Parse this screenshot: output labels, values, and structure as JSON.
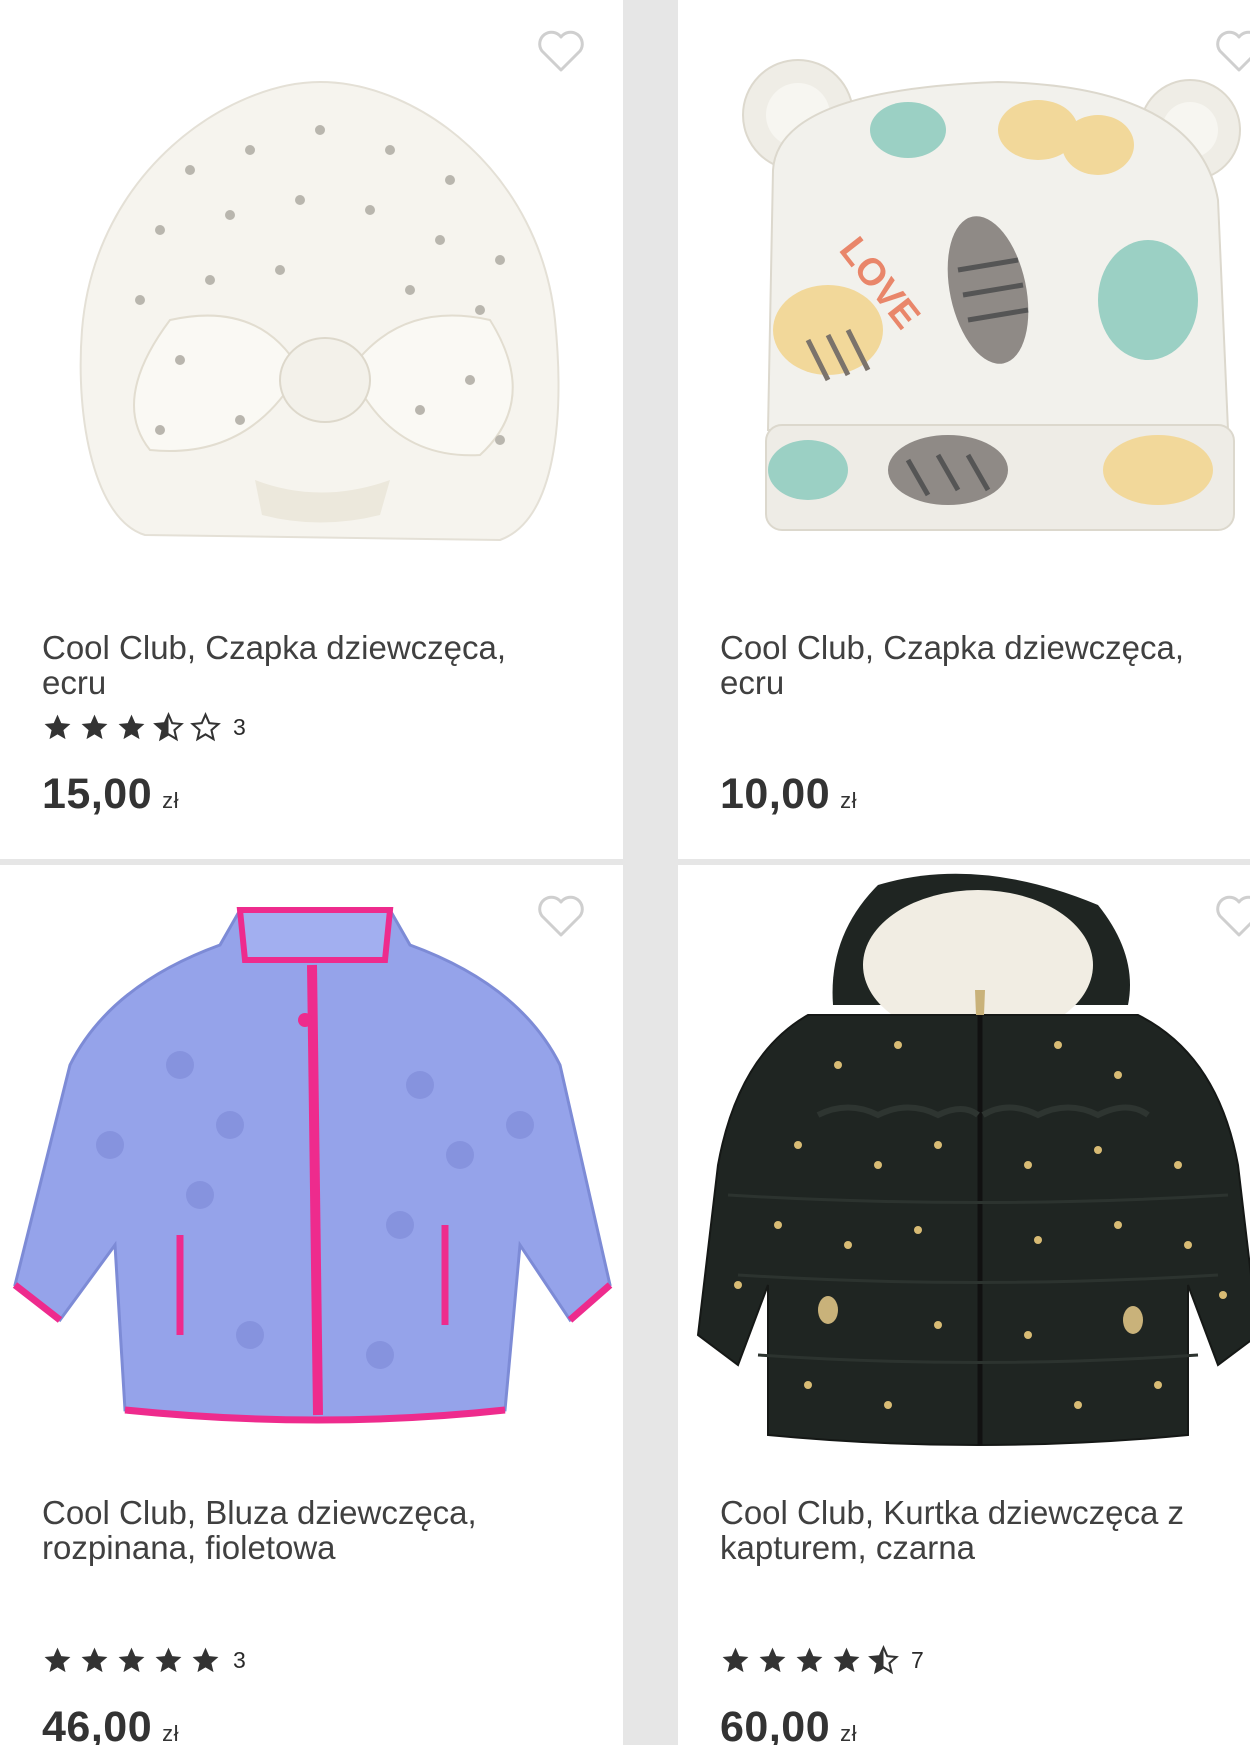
{
  "products": [
    {
      "title_line1": "Cool Club, Czapka dziewczęca,",
      "title_line2": "ecru",
      "rating": 3.5,
      "rating_count": "3",
      "price": "15,00",
      "currency": "zł",
      "image": "white-turban-hat"
    },
    {
      "title_line1": "Cool Club, Czapka dziewczęca,",
      "title_line2": "ecru",
      "rating": null,
      "rating_count": "",
      "price": "10,00",
      "currency": "zł",
      "image": "tiger-print-hat-with-ears"
    },
    {
      "title_line1": "Cool Club, Bluza dziewczęca,",
      "title_line2": "rozpinana, fioletowa",
      "rating": 5,
      "rating_count": "3",
      "price": "46,00",
      "currency": "zł",
      "image": "purple-fleece-jacket"
    },
    {
      "title_line1": "Cool Club, Kurtka dziewczęca z",
      "title_line2": "kapturem, czarna",
      "rating": 4.5,
      "rating_count": "7",
      "price": "60,00",
      "currency": "zł",
      "image": "black-star-puffer-jacket"
    }
  ],
  "icons": {
    "favorite": "heart-outline-icon",
    "star_full": "star-filled-icon",
    "star_half": "star-half-icon",
    "star_empty": "star-outline-icon"
  },
  "colors": {
    "star": "#333333",
    "heart": "#cfcfcf",
    "card_bg": "#ffffff",
    "page_bg": "#e6e6e6"
  }
}
